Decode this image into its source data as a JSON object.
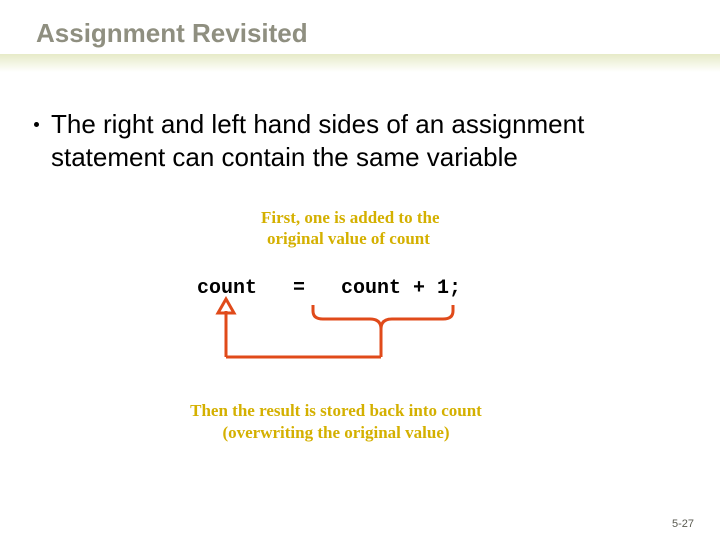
{
  "title": "Assignment Revisited",
  "bullet": "The right and left hand sides of an assignment statement can contain the same variable",
  "annotation_top_line1": "First, one is added to the",
  "annotation_top_line2": "original value of count",
  "code": "count   =   count + 1;",
  "annotation_bottom_line1": "Then the result is stored back into count",
  "annotation_bottom_line2": "(overwriting the original value)",
  "footer": "5-27"
}
